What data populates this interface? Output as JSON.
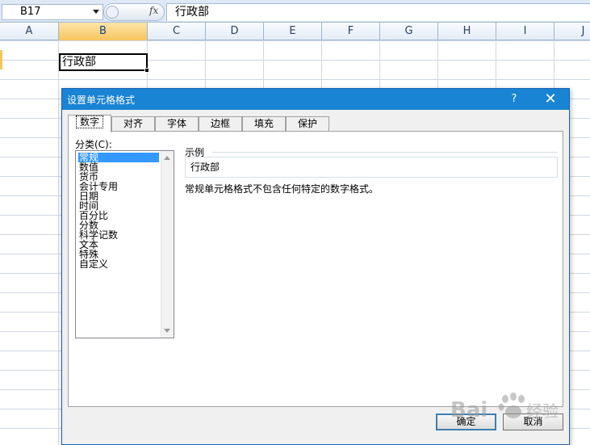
{
  "formula_bar": {
    "name_box": "B17",
    "fx_label": "fx",
    "formula_value": "行政部"
  },
  "sheet": {
    "columns": [
      "A",
      "B",
      "C",
      "D",
      "E",
      "F",
      "G",
      "H",
      "I",
      "J"
    ],
    "selected_column": "B",
    "active_cell_value": "行政部"
  },
  "dialog": {
    "title": "设置单元格格式",
    "help": "?",
    "close": "✕",
    "tabs": [
      "数字",
      "对齐",
      "字体",
      "边框",
      "填充",
      "保护"
    ],
    "active_tab": "数字",
    "category_label": "分类(C):",
    "categories": [
      "常规",
      "数值",
      "货币",
      "会计专用",
      "日期",
      "时间",
      "百分比",
      "分数",
      "科学记数",
      "文本",
      "特殊",
      "自定义"
    ],
    "selected_category": "常规",
    "sample_label": "示例",
    "sample_value": "行政部",
    "description": "常规单元格格式不包含任何特定的数字格式。",
    "ok_label": "确定",
    "cancel_label": "取消"
  },
  "watermark": {
    "text": "Bai",
    "suffix": "经验"
  },
  "colors": {
    "title_bar": "#1983d4",
    "selection": "#3399ff",
    "header_highlight": "#f7c55e",
    "grid": "#d0d7e5"
  }
}
